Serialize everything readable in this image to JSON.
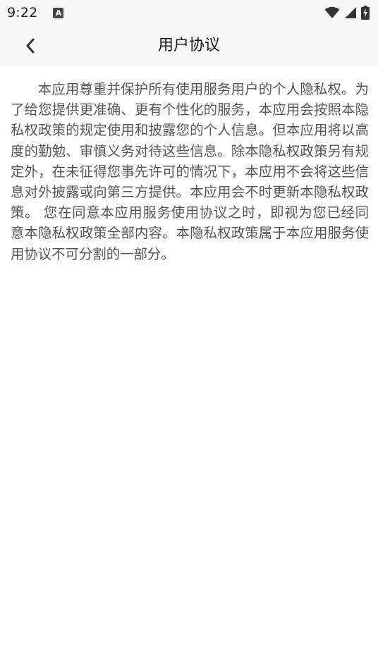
{
  "status_bar": {
    "time": "9:22",
    "notification_icon": "text-a-icon",
    "icons": [
      "wifi-icon",
      "cell-signal-icon",
      "battery-charging-icon"
    ]
  },
  "header": {
    "title": "用户协议",
    "back_icon": "chevron-left-icon"
  },
  "colors": {
    "bar_background": "#f7f7f7",
    "body_text": "#555555",
    "title_text": "#1a1a1a"
  },
  "content": {
    "paragraph": "本应用尊重并保护所有使用服务用户的个人隐私权。为了给您提供更准确、更有个性化的服务，本应用会按照本隐私权政策的规定使用和披露您的个人信息。但本应用将以高度的勤勉、审慎义务对待这些信息。除本隐私权政策另有规定外，在未征得您事先许可的情况下，本应用不会将这些信息对外披露或向第三方提供。本应用会不时更新本隐私权政策。 您在同意本应用服务使用协议之时，即视为您已经同意本隐私权政策全部内容。本隐私权政策属于本应用服务使用协议不可分割的一部分。"
  }
}
